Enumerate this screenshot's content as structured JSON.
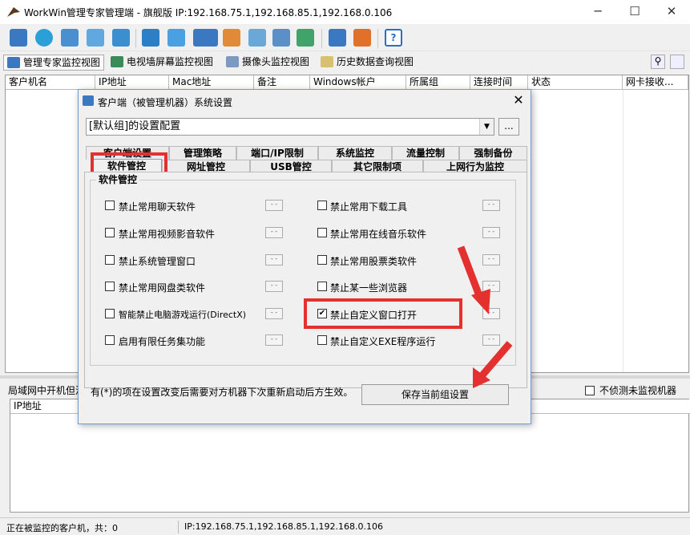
{
  "window": {
    "title": "WorkWin管理专家管理端 - 旗舰版 IP:192.168.75.1,192.168.85.1,192.168.0.106",
    "minimize": "─",
    "maximize": "☐",
    "close": "✕"
  },
  "toolbar": {
    "icons": [
      "client-icon",
      "globe-icon",
      "group-settings-icon",
      "network-scan-icon",
      "user-admin-icon",
      "app-grid-icon",
      "message-icon",
      "lock-icon",
      "monitor-icon",
      "remote-icon",
      "search-files-icon",
      "screens-icon",
      "report-icon",
      "ip-icon",
      "alert-icon",
      "help-icon"
    ]
  },
  "view_tabs": [
    {
      "label": "管理专家监控视图"
    },
    {
      "label": "电视墙屏幕监控视图"
    },
    {
      "label": "摄像头监控视图"
    },
    {
      "label": "历史数据查询视图"
    }
  ],
  "client_table": {
    "headers": [
      "客户机名",
      "IP地址",
      "Mac地址",
      "备注",
      "Windows帐户",
      "所属组",
      "连接时间",
      "状态",
      "网卡接收..."
    ]
  },
  "lan_section": {
    "label": "局域网中开机但没",
    "no_detect_label": "不侦测未监视机器",
    "headers": [
      "IP地址"
    ]
  },
  "status": {
    "left": "正在被监控的客户机，共：0",
    "right": "IP:192.168.75.1,192.168.85.1,192.168.0.106"
  },
  "dialog": {
    "title": "客户端（被管理机器）系统设置",
    "close": "✕",
    "group_select": "[默认组]的设置配置",
    "group_button": "...",
    "tabs_row1": [
      "客户端设置",
      "管理策略",
      "端口/IP限制",
      "系统监控",
      "流量控制",
      "强制备份"
    ],
    "tabs_row2": [
      "软件管控",
      "网址管控",
      "USB管控",
      "其它限制项",
      "上网行为监控"
    ],
    "groupbox_label": "软件管控",
    "options_left": [
      {
        "label": "禁止常用聊天软件",
        "checked": false
      },
      {
        "label": "禁止常用视频影音软件",
        "checked": false
      },
      {
        "label": "禁止系统管理窗口",
        "checked": false
      },
      {
        "label": "禁止常用网盘类软件",
        "checked": false
      },
      {
        "label": "智能禁止电脑游戏运行(DirectX)",
        "checked": false
      },
      {
        "label": "启用有限任务集功能",
        "checked": false
      }
    ],
    "options_right": [
      {
        "label": "禁止常用下载工具",
        "checked": false
      },
      {
        "label": "禁止常用在线音乐软件",
        "checked": false
      },
      {
        "label": "禁止常用股票类软件",
        "checked": false
      },
      {
        "label": "禁止某一些浏览器",
        "checked": false
      },
      {
        "label": "禁止自定义窗口打开",
        "checked": true
      },
      {
        "label": "禁止自定义EXE程序运行",
        "checked": false
      }
    ],
    "mini_button": "- -",
    "note": "有(*)的项在设置改变后需要对方机器下次重新启动后方生效。",
    "save_button": "保存当前组设置"
  },
  "colors": {
    "highlight": "#e53030",
    "accent": "#3a78c2"
  }
}
